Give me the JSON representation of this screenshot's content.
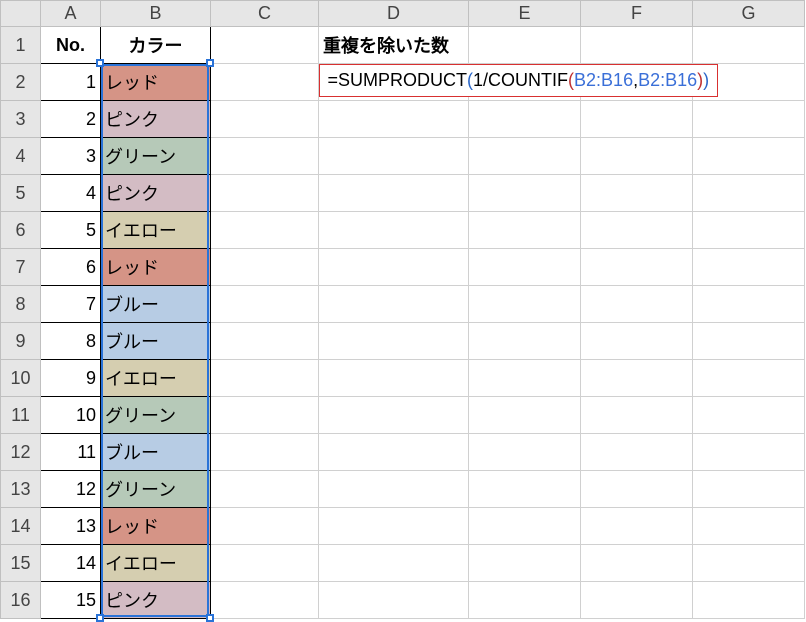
{
  "columns": [
    "A",
    "B",
    "C",
    "D",
    "E",
    "F",
    "G"
  ],
  "row_count": 16,
  "headers": {
    "A1": "No.",
    "B1": "カラー",
    "D1": "重複を除いた数"
  },
  "rows": [
    {
      "no": 1,
      "color": "レッド",
      "fill": "c-red"
    },
    {
      "no": 2,
      "color": "ピンク",
      "fill": "c-pink"
    },
    {
      "no": 3,
      "color": "グリーン",
      "fill": "c-green"
    },
    {
      "no": 4,
      "color": "ピンク",
      "fill": "c-pink"
    },
    {
      "no": 5,
      "color": "イエロー",
      "fill": "c-yellow"
    },
    {
      "no": 6,
      "color": "レッド",
      "fill": "c-red"
    },
    {
      "no": 7,
      "color": "ブルー",
      "fill": "c-blue"
    },
    {
      "no": 8,
      "color": "ブルー",
      "fill": "c-blue"
    },
    {
      "no": 9,
      "color": "イエロー",
      "fill": "c-yellow"
    },
    {
      "no": 10,
      "color": "グリーン",
      "fill": "c-green"
    },
    {
      "no": 11,
      "color": "ブルー",
      "fill": "c-blue"
    },
    {
      "no": 12,
      "color": "グリーン",
      "fill": "c-green"
    },
    {
      "no": 13,
      "color": "レッド",
      "fill": "c-red"
    },
    {
      "no": 14,
      "color": "イエロー",
      "fill": "c-yellow"
    },
    {
      "no": 15,
      "color": "ピンク",
      "fill": "c-pink"
    }
  ],
  "formula": {
    "eq": "=",
    "fn1": "SUMPRODUCT",
    "open1": "(",
    "mid": "1/",
    "fn2": "COUNTIF",
    "open2": "(",
    "ref1": "B2:B16",
    "comma": ",",
    "ref2": "B2:B16",
    "close2": ")",
    "close1": ")"
  }
}
